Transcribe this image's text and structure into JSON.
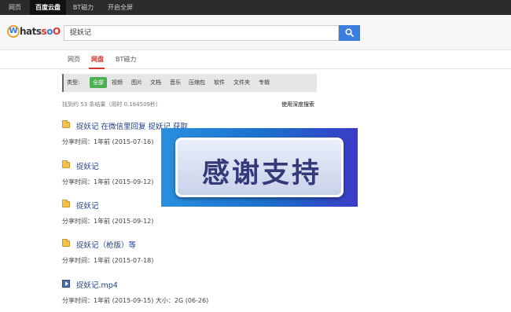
{
  "topbar": {
    "tabs": [
      {
        "label": "网页",
        "active": false
      },
      {
        "label": "百度云盘",
        "active": true
      },
      {
        "label": "BT磁力",
        "active": false
      },
      {
        "label": "开启全屏",
        "active": false
      }
    ]
  },
  "logo": {
    "w": "W",
    "text_a": "hats",
    "text_b": "o",
    "text_c": "O"
  },
  "search": {
    "value": "捉妖记",
    "button_icon": "search-icon",
    "accent": "#3a7ee0"
  },
  "navtabs": [
    {
      "label": "网页",
      "active": false
    },
    {
      "label": "网盘",
      "active": true
    },
    {
      "label": "BT磁力",
      "active": false
    }
  ],
  "filters": {
    "label": "类型:",
    "items": [
      {
        "label": "全部",
        "active": true
      },
      {
        "label": "视频",
        "active": false
      },
      {
        "label": "图片",
        "active": false
      },
      {
        "label": "文档",
        "active": false
      },
      {
        "label": "音乐",
        "active": false
      },
      {
        "label": "压缩包",
        "active": false
      },
      {
        "label": "软件",
        "active": false
      },
      {
        "label": "文件夹",
        "active": false
      },
      {
        "label": "专辑",
        "active": false
      }
    ],
    "active_color": "#4caf50"
  },
  "result_count": "找到约 53 条结果（用时 0.164509秒）",
  "deep_search": "使用深度搜索",
  "results": [
    {
      "icon": "folder-icon",
      "title": "捉妖记 在微信里回复 捉妖记 获取",
      "meta": "分享时间：1年前 (2015-07-16)"
    },
    {
      "icon": "folder-icon",
      "title": "捉妖记",
      "meta": "分享时间：1年前 (2015-09-12)"
    },
    {
      "icon": "folder-icon",
      "title": "捉妖记",
      "meta": "分享时间：1年前 (2015-09-12)"
    },
    {
      "icon": "folder-icon",
      "title": "捉妖记（枪版）等",
      "meta": "分享时间：1年前 (2015-07-18)"
    },
    {
      "icon": "video-icon",
      "title": "捉妖记.mp4",
      "meta": "分享时间：1年前 (2015-09-15) 大小：2G (06-26)"
    }
  ],
  "banner": {
    "text": "感谢支持"
  }
}
